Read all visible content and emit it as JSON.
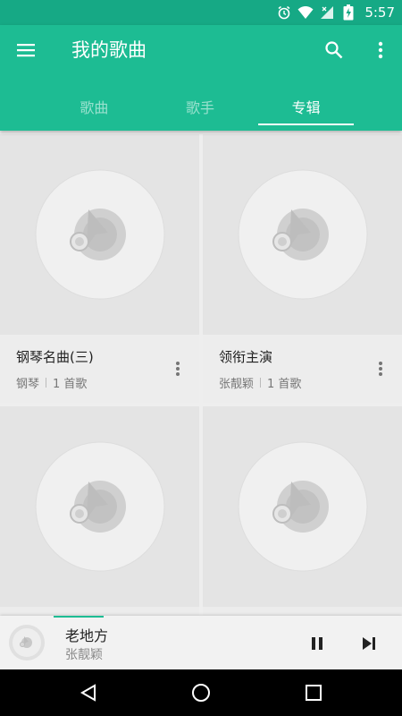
{
  "status_bar": {
    "time": "5:57",
    "icons": [
      "alarm-icon",
      "wifi-icon",
      "signal-icon",
      "battery-icon"
    ]
  },
  "app_bar": {
    "title": "我的歌曲",
    "icons": {
      "menu": "menu-icon",
      "search": "search-icon",
      "more": "more-vert-icon"
    }
  },
  "tabs": [
    {
      "label": "歌曲",
      "active": false
    },
    {
      "label": "歌手",
      "active": false
    },
    {
      "label": "专辑",
      "active": true
    }
  ],
  "albums": [
    {
      "title": "钢琴名曲(三)",
      "artist": "钢琴",
      "count": "1 首歌"
    },
    {
      "title": "领衔主演",
      "artist": "张靓颖",
      "count": "1 首歌"
    },
    {
      "title": "",
      "artist": "",
      "count": ""
    },
    {
      "title": "",
      "artist": "",
      "count": ""
    }
  ],
  "player": {
    "song": "老地方",
    "artist": "张靓颖",
    "progress": 0.12
  },
  "colors": {
    "accent": "#1dbc93",
    "status_bar": "#16a985"
  }
}
